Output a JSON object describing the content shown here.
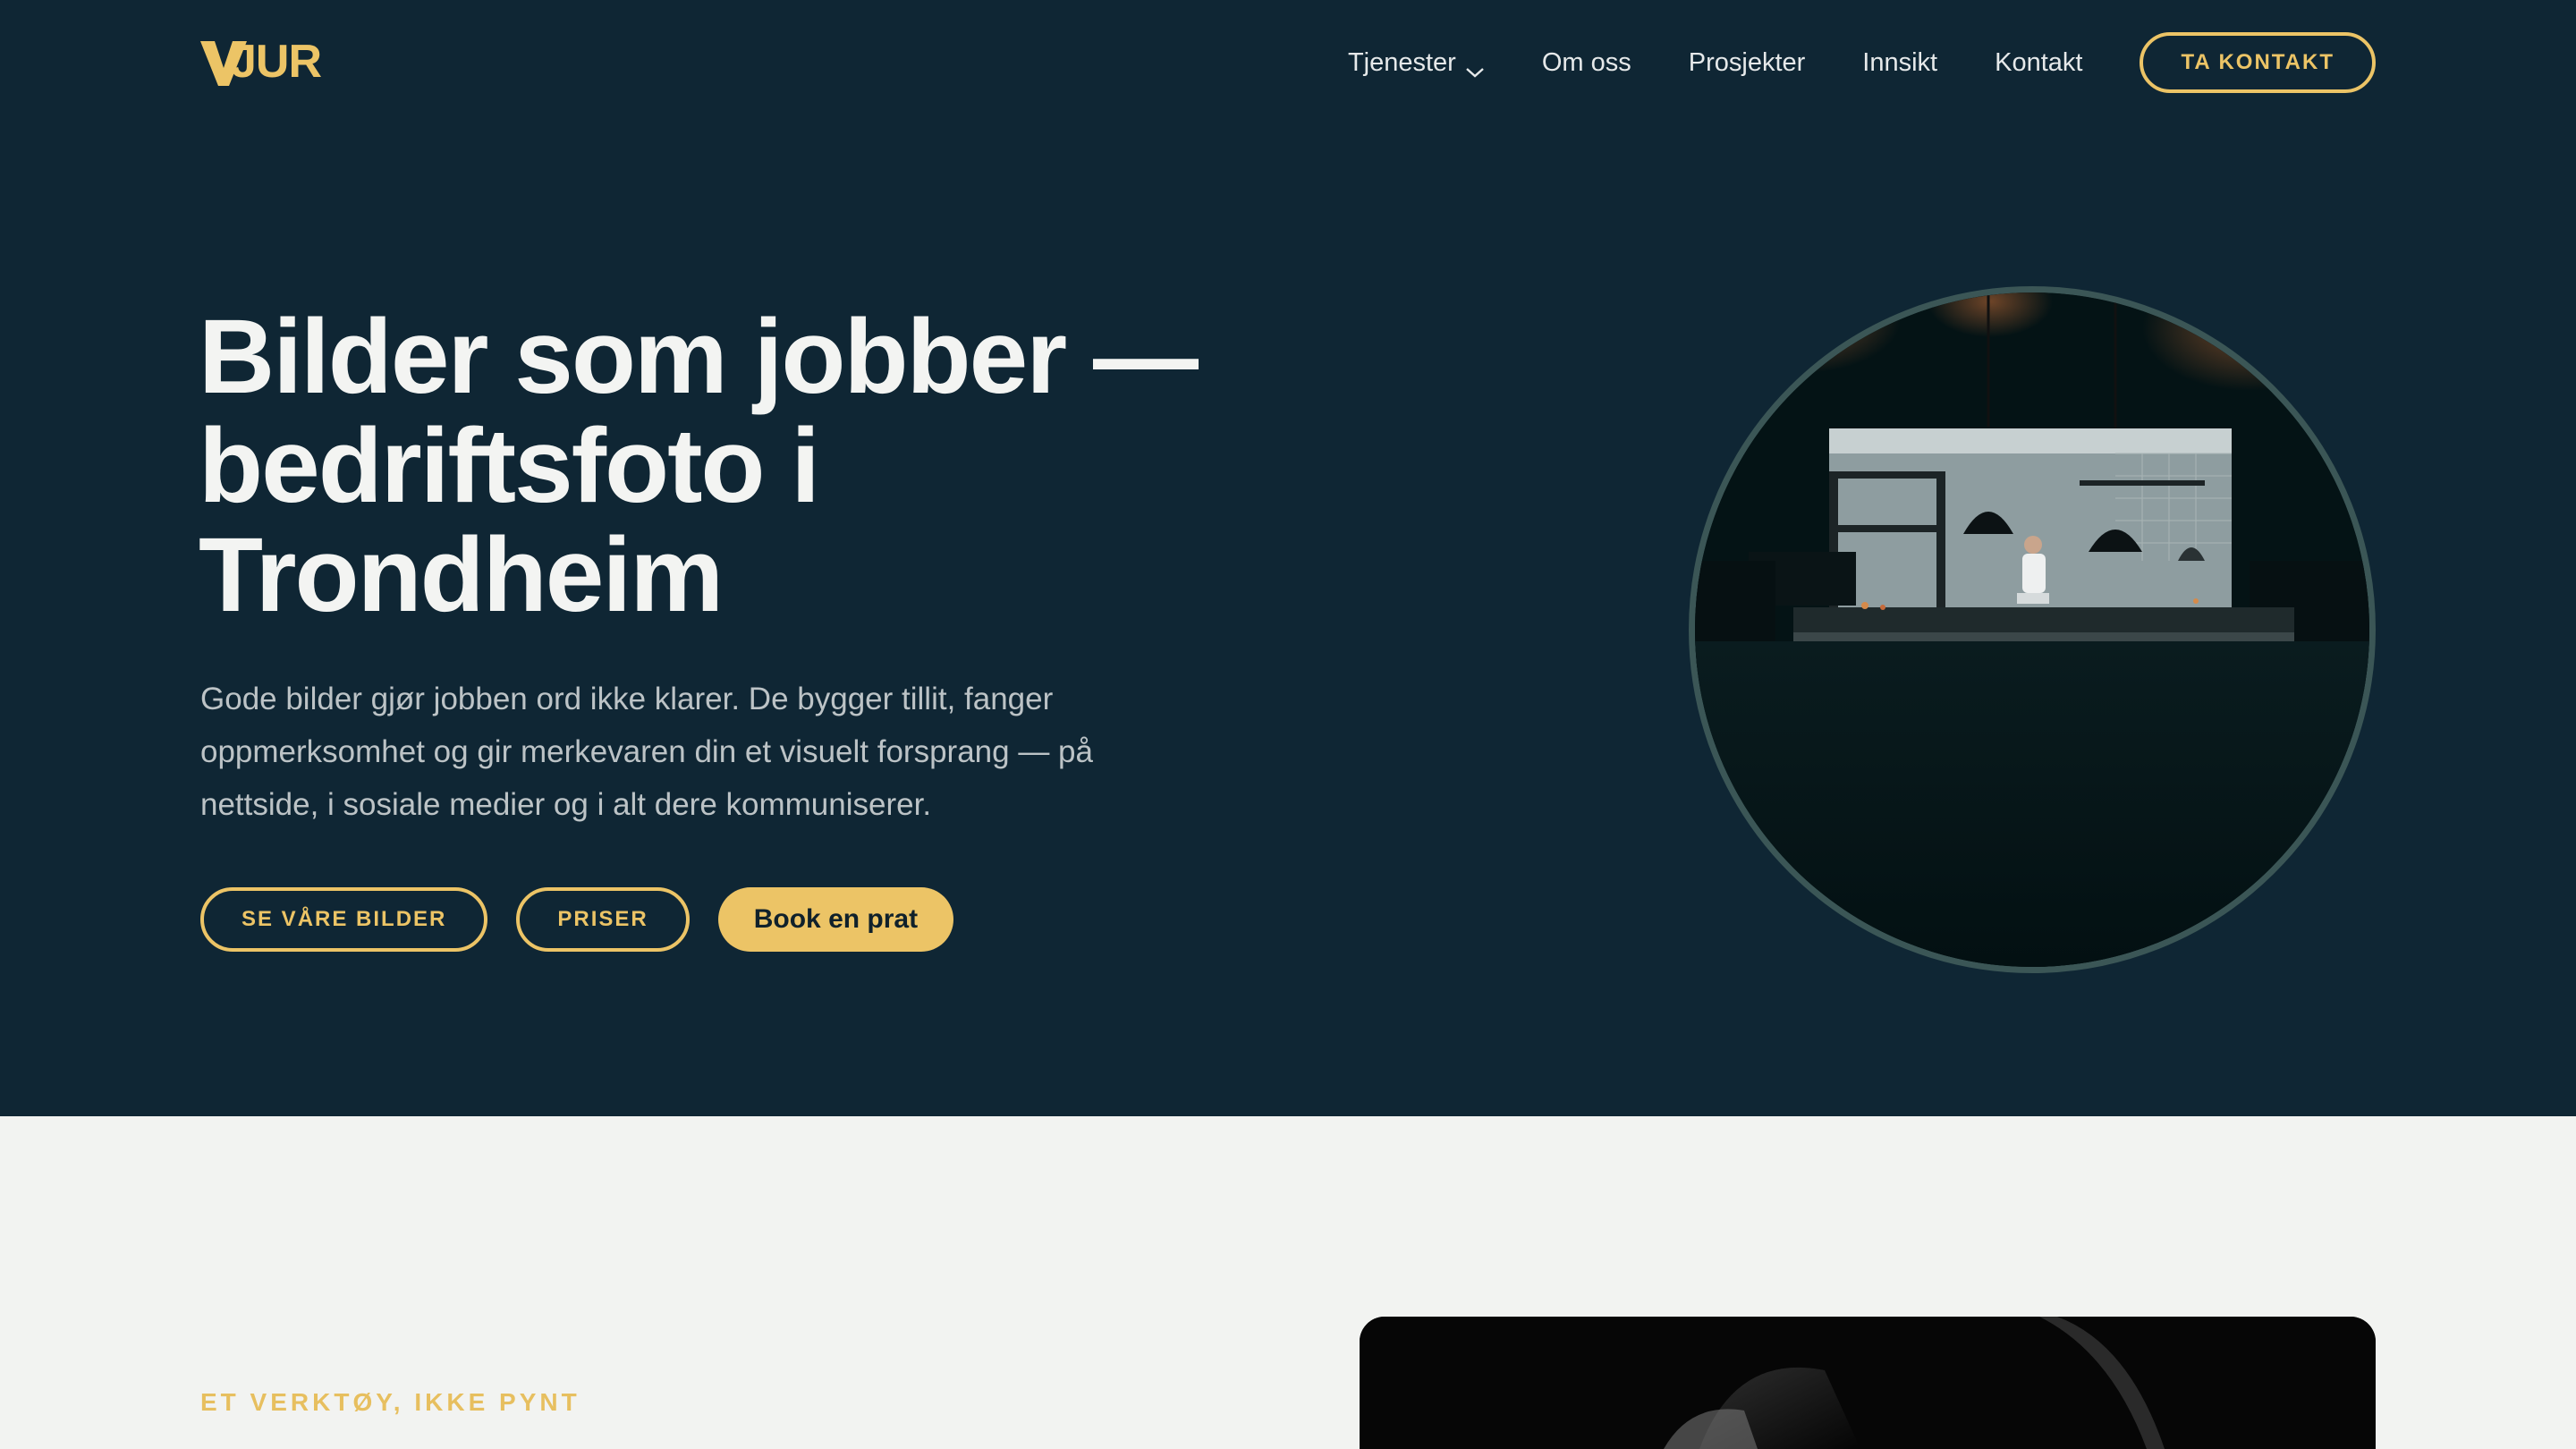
{
  "brand": {
    "logo_text": "VJUR"
  },
  "nav": {
    "items": [
      {
        "label": "Tjenester",
        "has_dropdown": true
      },
      {
        "label": "Om oss"
      },
      {
        "label": "Prosjekter"
      },
      {
        "label": "Innsikt"
      },
      {
        "label": "Kontakt"
      }
    ],
    "cta_label": "TA KONTAKT"
  },
  "hero": {
    "title_lines": [
      "Bilder som jobber —",
      "bedriftsfoto i",
      "Trondheim"
    ],
    "lead": "Gode bilder gjør jobben ord ikke klarer. De bygger tillit, fanger oppmerksomhet og gir merkevaren din et visuelt forsprang — på nettside, i sosiale medier og i alt dere kommuniserer.",
    "buttons": {
      "primary_outline": "SE VÅRE BILDER",
      "secondary_outline": "PRISER",
      "solid": "Book en prat"
    },
    "photo_subject": "restaurant kitchen with chef"
  },
  "section2": {
    "eyebrow": "ET VERKTØY, IKKE PYNT",
    "photo_subject": "black and white close-up photo"
  },
  "colors": {
    "hero_bg": "#0f2634",
    "accent": "#ecc466",
    "section_bg": "#f2f3f1",
    "text_light": "#f3f4f2",
    "text_muted": "#bcc3c6"
  },
  "icons": {
    "dropdown": "chevron-down-icon"
  }
}
